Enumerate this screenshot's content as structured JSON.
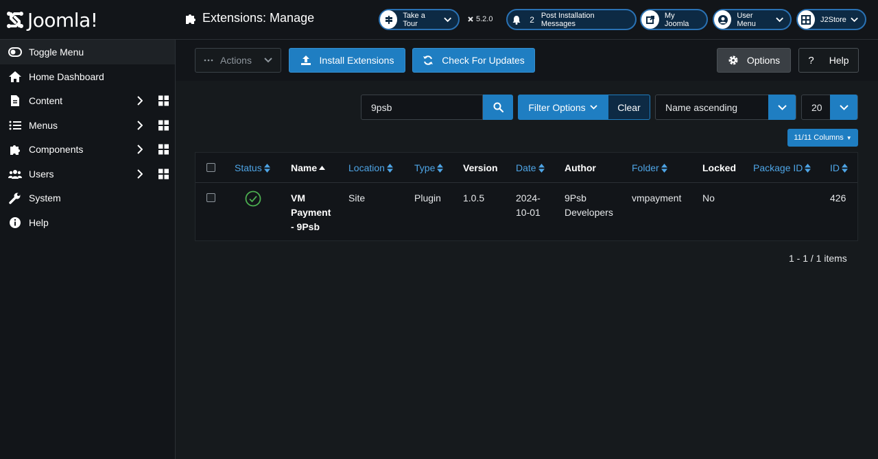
{
  "header": {
    "brand": "Joomla!",
    "page_title": "Extensions: Manage",
    "tour_label": "Take a Tour",
    "version": "5.2.0",
    "notif_count": "2",
    "notif_label": "Post Installation Messages",
    "my_joomla_label": "My Joomla",
    "user_menu_label": "User Menu",
    "j2store_label": "J2Store"
  },
  "sidebar": {
    "items": [
      {
        "label": "Toggle Menu"
      },
      {
        "label": "Home Dashboard"
      },
      {
        "label": "Content"
      },
      {
        "label": "Menus"
      },
      {
        "label": "Components"
      },
      {
        "label": "Users"
      },
      {
        "label": "System"
      },
      {
        "label": "Help"
      }
    ]
  },
  "toolbar": {
    "actions_label": "Actions",
    "install_label": "Install Extensions",
    "updates_label": "Check For Updates",
    "options_label": "Options",
    "help_label": "Help"
  },
  "filters": {
    "search_value": "9psb",
    "filter_options_label": "Filter Options",
    "clear_label": "Clear",
    "sort_value": "Name ascending",
    "limit_value": "20",
    "columns_label": "11/11 Columns"
  },
  "table": {
    "headers": {
      "status": "Status",
      "name": "Name",
      "location": "Location",
      "type": "Type",
      "version": "Version",
      "date": "Date",
      "author": "Author",
      "folder": "Folder",
      "locked": "Locked",
      "package_id": "Package ID",
      "id": "ID"
    },
    "rows": [
      {
        "status": "enabled",
        "name_lines": [
          "VM",
          "Payment",
          "- 9Psb"
        ],
        "location": "Site",
        "type": "Plugin",
        "version": "1.0.5",
        "date_lines": [
          "2024-",
          "10-01"
        ],
        "author_lines": [
          "9Psb",
          "Developers"
        ],
        "folder": "vmpayment",
        "locked": "No",
        "package_id": "",
        "id": "426"
      }
    ]
  },
  "pagination": {
    "summary": "1 - 1 / 1 items"
  },
  "colors": {
    "accent": "#1f7ec2",
    "link": "#4ea5e6",
    "success": "#4caf50"
  }
}
